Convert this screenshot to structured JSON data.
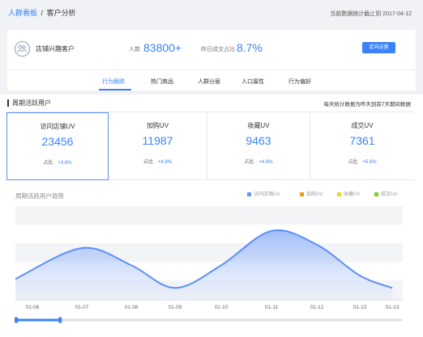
{
  "header": {
    "breadcrumb_root": "人群看板",
    "breadcrumb_sep": "/",
    "breadcrumb_current": "客户分析",
    "updated_text": "当前数据统计截止到 2017-04-12"
  },
  "shop": {
    "name": "店铺兴趣客户",
    "people_label": "人数",
    "people_value": "83800+",
    "ratio_label": "昨日成交占比",
    "ratio_value": "8.7%",
    "button_label": "定向运营"
  },
  "tabs": [
    "行为跟踪",
    "热门商品",
    "人群分层",
    "人口属性",
    "行为偏好"
  ],
  "weekly": {
    "title": "周期活跃用户",
    "note": "每天统计数据为昨天到前7天期间数据",
    "stats": [
      {
        "title": "访问店铺UV",
        "value": "23456",
        "ratio_label": "占比",
        "ratio": "+3.6%"
      },
      {
        "title": "加购UV",
        "value": "11987",
        "ratio_label": "占比",
        "ratio": "+4.9%"
      },
      {
        "title": "收藏UV",
        "value": "9463",
        "ratio_label": "占比",
        "ratio": "+4.9%"
      },
      {
        "title": "成交UV",
        "value": "7361",
        "ratio_label": "占比",
        "ratio": "+5.6%"
      }
    ]
  },
  "chart_data": {
    "type": "area",
    "title": "周期活跃用户趋势",
    "legend_position": "top-right",
    "legend": [
      {
        "name": "访问店铺UV",
        "color": "#6b95f5"
      },
      {
        "name": "加购UV",
        "color": "#f39c12"
      },
      {
        "name": "收藏UV",
        "color": "#f5d723"
      },
      {
        "name": "成交UV",
        "color": "#7ed321"
      }
    ],
    "x": [
      "01-06",
      "01-07",
      "01-08",
      "01-09",
      "01-10",
      "01-11",
      "01-12",
      "01-13",
      "01-13"
    ],
    "series": [
      {
        "name": "访问店铺UV",
        "values": [
          0.15,
          0.6,
          0.35,
          0.02,
          0.35,
          0.85,
          0.65,
          0.2,
          0.02
        ]
      }
    ],
    "grid": true,
    "dataZoom": {
      "start": 0.0,
      "end": 0.08
    }
  }
}
